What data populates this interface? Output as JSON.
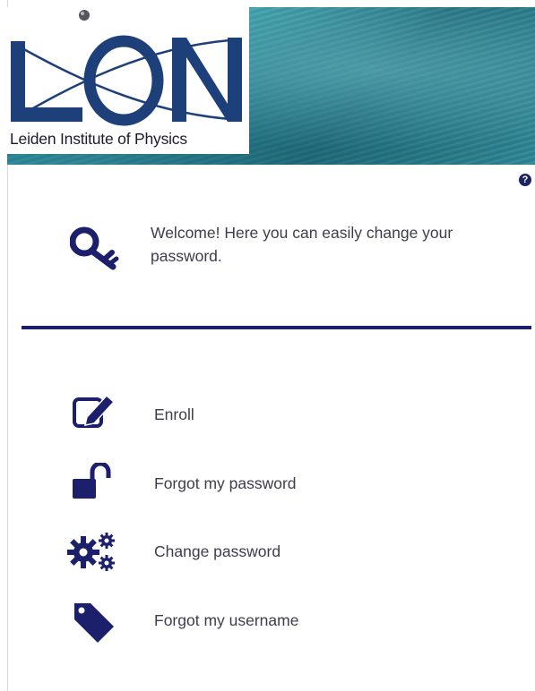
{
  "banner": {
    "logo_caption": "Leiden Institute of Physics",
    "logo_letters": "LION"
  },
  "help": {
    "icon": "help-icon",
    "glyph": "?"
  },
  "welcome": {
    "icon": "key-icon",
    "text": "Welcome! Here you can easily change your password."
  },
  "menu": {
    "items": [
      {
        "label": "Enroll",
        "icon": "edit-icon"
      },
      {
        "label": "Forgot my password",
        "icon": "unlock-icon"
      },
      {
        "label": "Change password",
        "icon": "gears-icon"
      },
      {
        "label": "Forgot my username",
        "icon": "tag-icon"
      }
    ]
  },
  "colors": {
    "accent": "#1c1f6b",
    "text": "#3d3d4d",
    "banner": "#2b8c9c"
  }
}
